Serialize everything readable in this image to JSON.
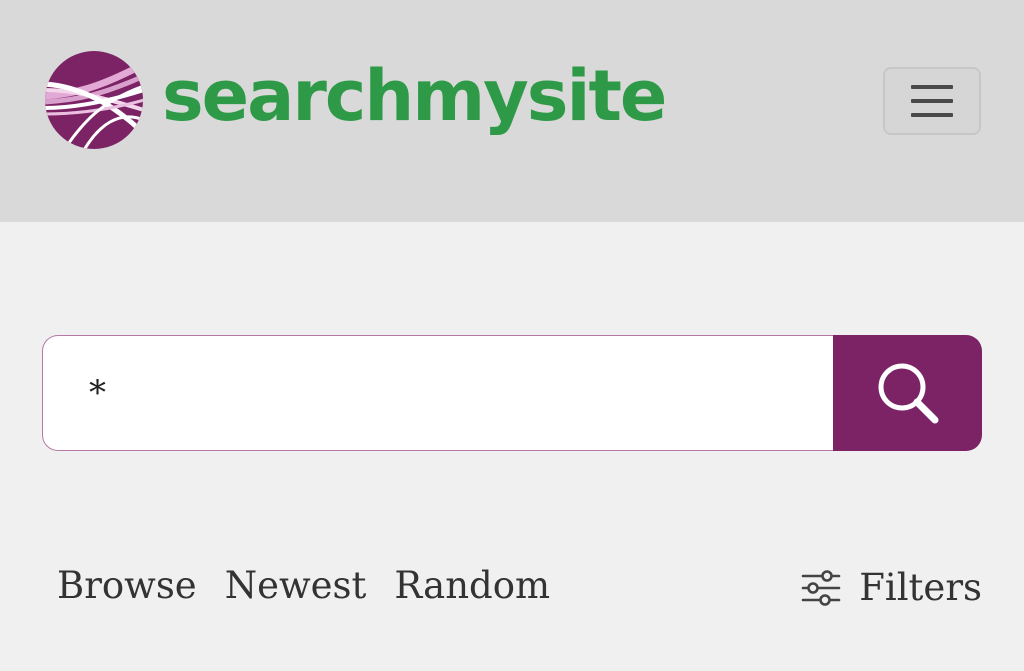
{
  "brand": {
    "name": "searchmysite",
    "logo_icon": "searchmysite-logo",
    "logo_color": "#7b2365",
    "text_color": "#2e9a47"
  },
  "header": {
    "menu_icon": "hamburger-icon"
  },
  "search": {
    "query": "*",
    "submit_icon": "search-icon",
    "accent": "#7b2365"
  },
  "nav": {
    "browse": "Browse",
    "newest": "Newest",
    "random": "Random"
  },
  "filters": {
    "label": "Filters",
    "icon": "sliders-icon"
  }
}
